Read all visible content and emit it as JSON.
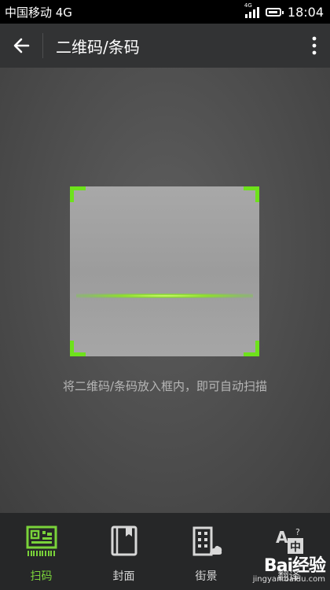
{
  "status_bar": {
    "carrier": "中国移动 4G",
    "network_badge": "4G",
    "time": "18:04"
  },
  "app_bar": {
    "title": "二维码/条码",
    "back_icon": "arrow-left-icon",
    "menu_icon": "more-vert-icon"
  },
  "scanner": {
    "hint": "将二维码/条码放入框内，即可自动扫描",
    "accent_color": "#6ee21b"
  },
  "tabs": [
    {
      "label": "扫码",
      "icon": "qr-scan-icon",
      "active": true
    },
    {
      "label": "封面",
      "icon": "book-icon",
      "active": false
    },
    {
      "label": "街景",
      "icon": "street-building-icon",
      "active": false
    },
    {
      "label": "翻译",
      "icon": "translate-icon",
      "active": false
    }
  ],
  "watermark": {
    "logo": "Bai经验",
    "url": "jingyan.baidu.com"
  }
}
